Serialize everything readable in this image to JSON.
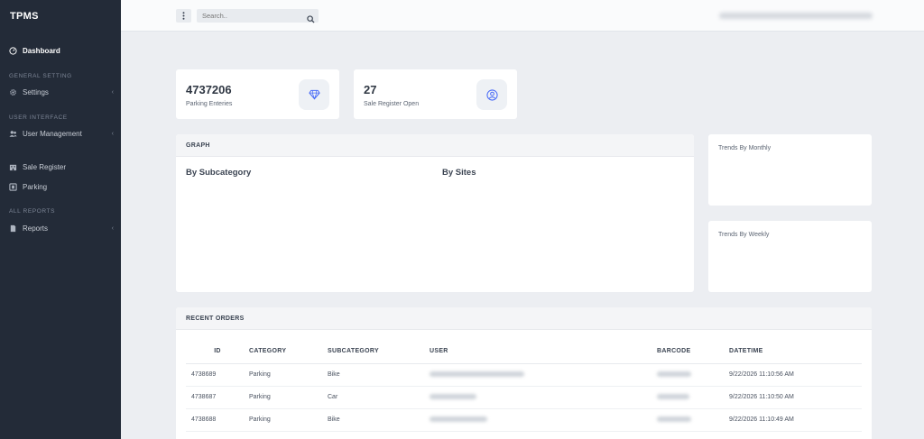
{
  "app": {
    "brand": "TPMS"
  },
  "sidebar": {
    "dashboard": "Dashboard",
    "sections": {
      "general": "GENERAL SETTING",
      "ui": "USER INTERFACE",
      "reports": "ALL REPORTS"
    },
    "items": {
      "settings": "Settings",
      "user_management": "User Management",
      "sale_register": "Sale Register",
      "parking": "Parking",
      "reports": "Reports"
    }
  },
  "topbar": {
    "search_placeholder": "Search.."
  },
  "stats": [
    {
      "value": "4737206",
      "label": "Parking Enteries",
      "icon": "diamond-icon"
    },
    {
      "value": "27",
      "label": "Sale Register Open",
      "icon": "user-circle-icon"
    }
  ],
  "graph": {
    "header": "GRAPH",
    "by_subcategory": "By Subcategory",
    "by_sites": "By Sites"
  },
  "trends": {
    "monthly": "Trends By Monthly",
    "weekly": "Trends By Weekly"
  },
  "orders": {
    "header": "RECENT ORDERS",
    "columns": [
      "ID",
      "CATEGORY",
      "SUBCATEGORY",
      "USER",
      "BARCODE",
      "DATETIME"
    ],
    "rows": [
      {
        "id": "4738689",
        "category": "Parking",
        "subcategory": "Bike",
        "datetime": "9/22/2026 11:10:56 AM"
      },
      {
        "id": "4738687",
        "category": "Parking",
        "subcategory": "Car",
        "datetime": "9/22/2026 11:10:50 AM"
      },
      {
        "id": "4738688",
        "category": "Parking",
        "subcategory": "Bike",
        "datetime": "9/22/2026 11:10:49 AM"
      }
    ]
  },
  "colors": {
    "sidebar": "#232b38",
    "accent": "#4a6cf7",
    "background": "#eceef2"
  }
}
